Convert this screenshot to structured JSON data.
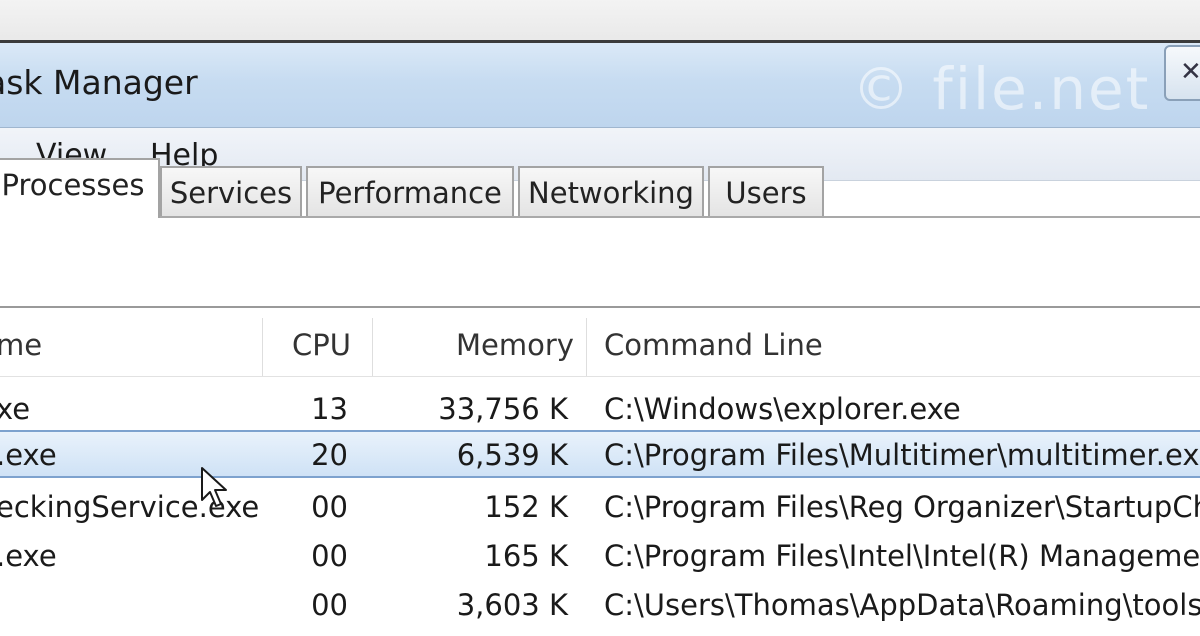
{
  "window": {
    "title": "ask Manager",
    "watermark": "© file.net",
    "close_glyph": "✕"
  },
  "menu": {
    "items": [
      {
        "label": "View"
      },
      {
        "label": "Help"
      }
    ]
  },
  "tabs": [
    {
      "label": "Processes",
      "active": true
    },
    {
      "label": "Services",
      "active": false
    },
    {
      "label": "Performance",
      "active": false
    },
    {
      "label": "Networking",
      "active": false
    },
    {
      "label": "Users",
      "active": false
    }
  ],
  "table": {
    "columns": {
      "name": "me",
      "cpu": "CPU",
      "memory": "Memory",
      "command": "Command Line"
    },
    "rows": [
      {
        "name": "xe",
        "cpu": "13",
        "memory": "33,756 K",
        "command": "C:\\Windows\\explorer.exe",
        "selected": false
      },
      {
        "name": ".exe",
        "cpu": "20",
        "memory": "6,539 K",
        "command": "C:\\Program Files\\Multitimer\\multitimer.exe",
        "selected": true
      },
      {
        "name": "eckingService.exe",
        "cpu": "00",
        "memory": "152 K",
        "command": "C:\\Program Files\\Reg Organizer\\StartupChe",
        "selected": false
      },
      {
        "name": ".exe",
        "cpu": "00",
        "memory": "165 K",
        "command": "C:\\Program Files\\Intel\\Intel(R) Managemen",
        "selected": false
      },
      {
        "name": "",
        "cpu": "00",
        "memory": "3,603 K",
        "command": "C:\\Users\\Thomas\\AppData\\Roaming\\toolsy",
        "selected": false
      }
    ]
  },
  "colors": {
    "selection_border": "#7da2ce",
    "titlebar": "#c7dcf1"
  },
  "icons": {
    "cursor": "mouse-pointer-icon",
    "close": "close-icon"
  }
}
